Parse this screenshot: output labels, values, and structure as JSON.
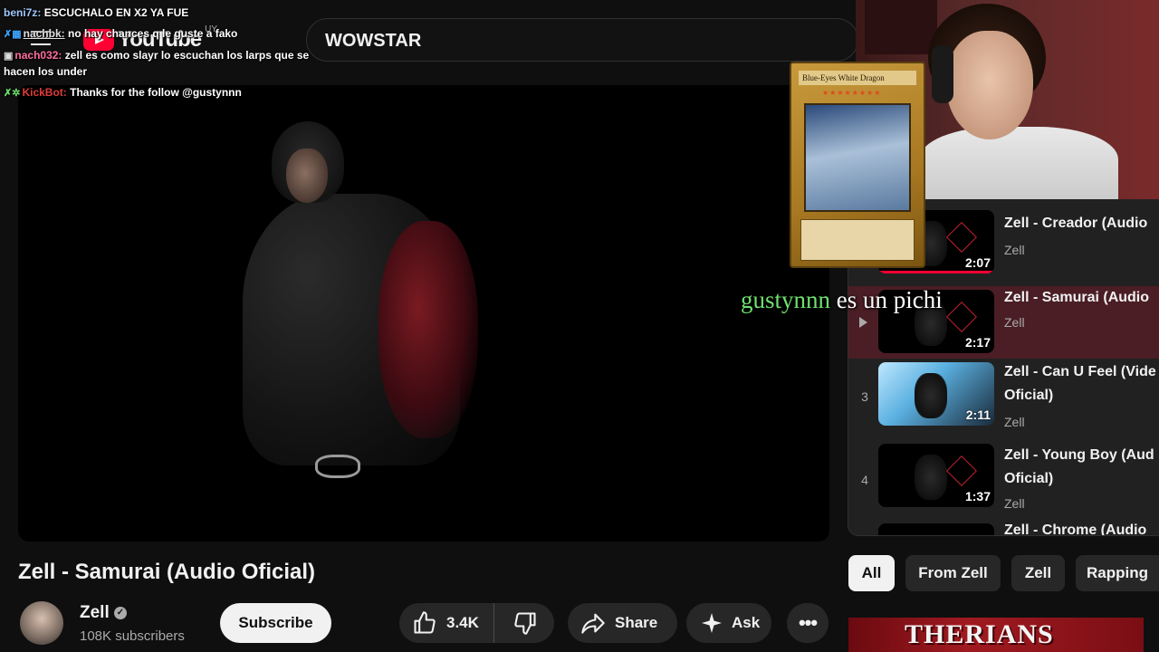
{
  "chat": [
    {
      "user": "beni7z:",
      "text": "ESCUCHALO EN X2 YA FUE"
    },
    {
      "user": "nachbk:",
      "text": "no hay chances q le guste a fako"
    },
    {
      "user": "nach032:",
      "text": "zell es como slayr lo escuchan los larps que se hacen los under"
    },
    {
      "user": "KickBot:",
      "text": "Thanks for the follow @gustynnn"
    }
  ],
  "header": {
    "logo_text": "YouTube",
    "logo_country": "UY",
    "search_value": "WOWSTAR"
  },
  "card": {
    "name": "Blue-Eyes White Dragon",
    "stars": "★★★★★★★★"
  },
  "overlay": {
    "name": "gustynnn",
    "text": "es un pichi"
  },
  "playlist": [
    {
      "index": "",
      "title": "Zell - Creador (Audio",
      "channel": "Zell",
      "duration": "2:07",
      "watched": 1.0,
      "active": false
    },
    {
      "index": "",
      "title": "Zell - Samurai (Audio",
      "channel": "Zell",
      "duration": "2:17",
      "watched": 0.0,
      "active": true
    },
    {
      "index": "3",
      "title": "Zell - Can U Feel (Vide Oficial)",
      "channel": "Zell",
      "duration": "2:11",
      "watched": 0.0,
      "active": false
    },
    {
      "index": "4",
      "title": "Zell - Young Boy (Aud Oficial)",
      "channel": "Zell",
      "duration": "1:37",
      "watched": 0.0,
      "active": false
    },
    {
      "index": "",
      "title": "Zell - Chrome (Audio",
      "channel": "",
      "duration": "",
      "watched": 0.0,
      "active": false
    }
  ],
  "video": {
    "title": "Zell - Samurai (Audio Oficial)",
    "channel": "Zell",
    "subscribers": "108K subscribers",
    "subscribe_label": "Subscribe",
    "likes": "3.4K",
    "share_label": "Share",
    "ask_label": "Ask",
    "more_label": "•••"
  },
  "chips": [
    "All",
    "From Zell",
    "Zell",
    "Rapping"
  ],
  "banner": {
    "text": "THERIANS"
  },
  "colors": {
    "accent": "#ff0033",
    "overlay_name": "#6ee06e",
    "background": "#0f0f0f"
  }
}
